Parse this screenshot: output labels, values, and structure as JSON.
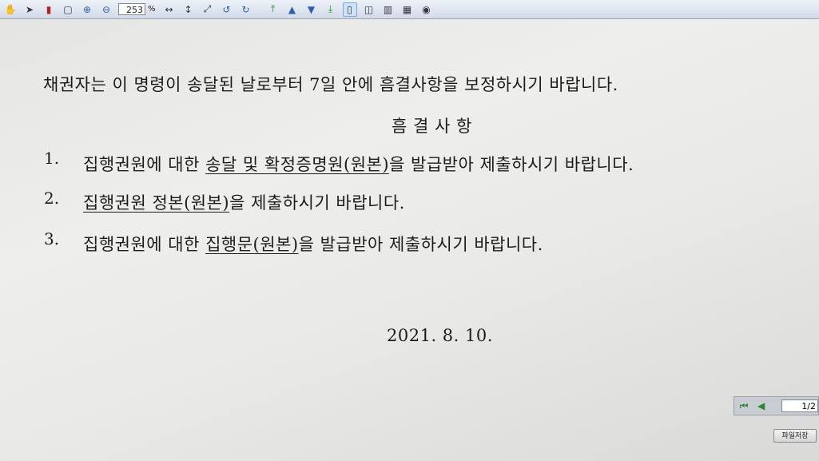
{
  "toolbar": {
    "zoom_value": "253",
    "zoom_unit": "%",
    "icons": [
      "hand-icon",
      "arrow-pointer-icon",
      "bookmark-icon",
      "rect-select-icon",
      "zoom-in-icon",
      "zoom-out-icon",
      "fit-width-icon",
      "fit-height-icon",
      "fit-page-icon",
      "rotate-left-icon",
      "rotate-right-icon",
      "first-page-icon",
      "prev-page-icon",
      "next-page-icon",
      "last-page-icon",
      "single-page-icon",
      "two-page-icon",
      "columns-icon",
      "grid-icon",
      "extra-icon"
    ]
  },
  "document": {
    "intro": "채권자는 이 명령이 송달된 날로부터 7일 안에 흠결사항을 보정하시기 바랍니다.",
    "heading": "흠 결 사 항",
    "items": [
      {
        "num": "1.",
        "pre": "집행권원에 대한 ",
        "underlined": "송달 및 확정증명원(원본)",
        "post": "을 발급받아 제출하시기 바랍니다."
      },
      {
        "num": "2.",
        "pre": "",
        "underlined": "집행권원 정본(원본)",
        "post": "을 제출하시기 바랍니다."
      },
      {
        "num": "3.",
        "pre": "집행권원에 대한 ",
        "underlined": "집행문(원본)",
        "post": "을 발급받아 제출하시기 바랍니다."
      }
    ],
    "date": "2021. 8. 10."
  },
  "pager": {
    "page_display": "1/2"
  },
  "save_button": {
    "label": "파일저장"
  }
}
